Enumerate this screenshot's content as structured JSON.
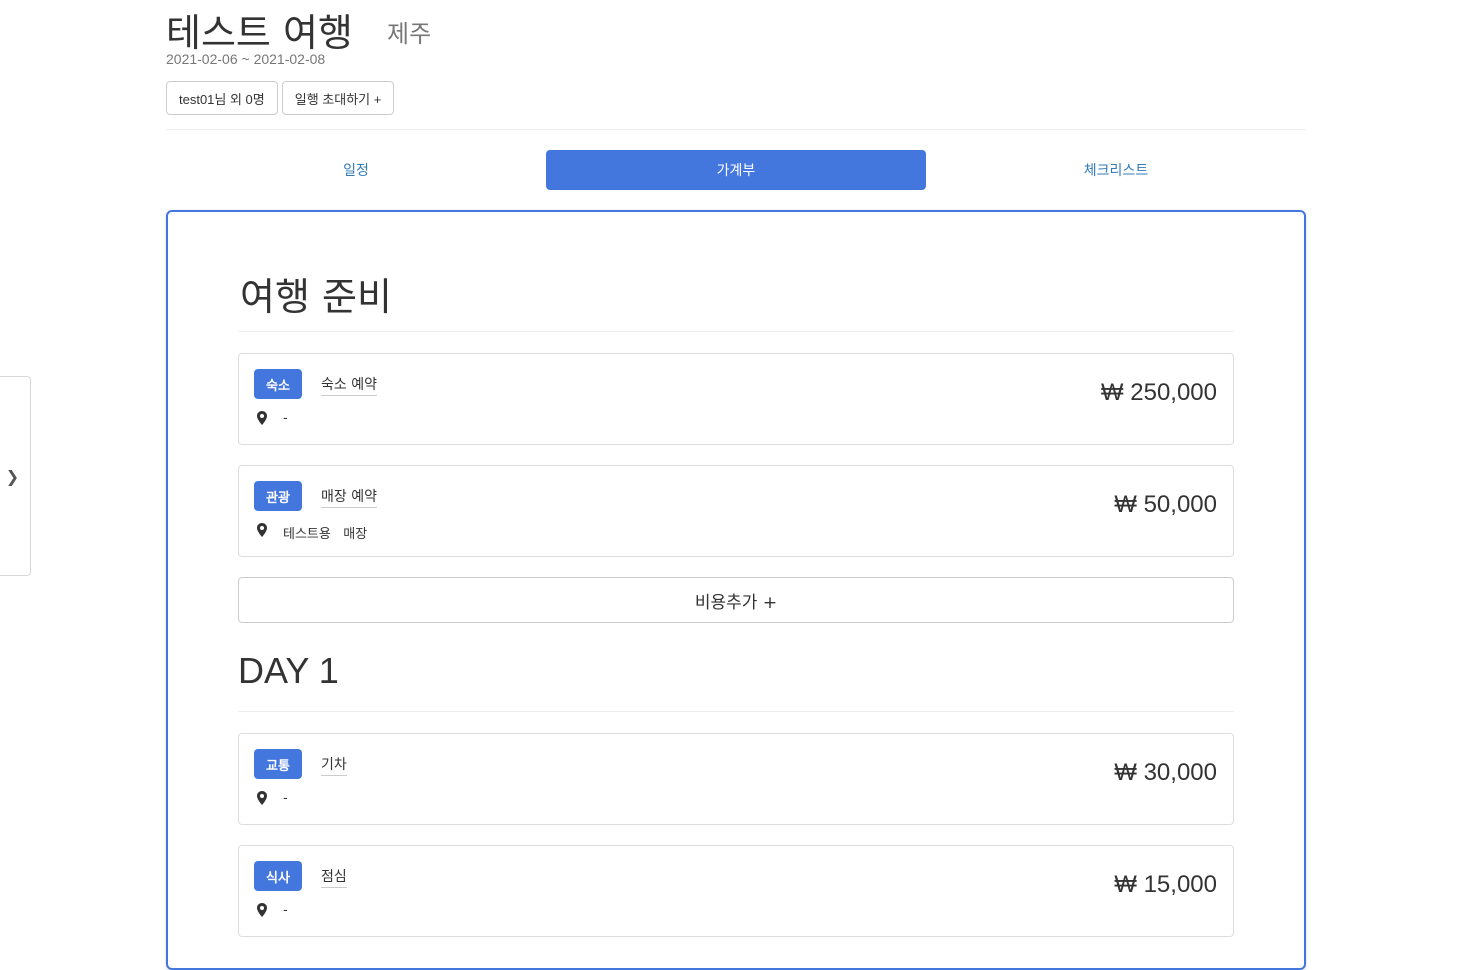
{
  "trip": {
    "title": "테스트 여행",
    "region": "제주",
    "dates": "2021-02-06 ~ 2021-02-08",
    "members_label": "test01님 외 0명",
    "invite_label": "일행 초대하기 +"
  },
  "tabs": [
    {
      "label": "일정",
      "active": false
    },
    {
      "label": "가계부",
      "active": true
    },
    {
      "label": "체크리스트",
      "active": false
    }
  ],
  "sidebar": {
    "toggle_icon": "chevron-right-icon"
  },
  "budget": {
    "prep": {
      "title": "여행 준비",
      "items": [
        {
          "category": "숙소",
          "name": "숙소 예약",
          "place": "-",
          "amount": "₩ 250,000"
        },
        {
          "category": "관광",
          "name": "매장 예약",
          "place": "테스트용   매장",
          "amount": "₩ 50,000"
        }
      ],
      "add_label": "비용추가 +"
    },
    "day1": {
      "title": "DAY 1",
      "items": [
        {
          "category": "교통",
          "name": "기차",
          "place": "-",
          "amount": "₩ 30,000"
        },
        {
          "category": "식사",
          "name": "점심",
          "place": "-",
          "amount": "₩ 15,000"
        }
      ]
    }
  },
  "colors": {
    "accent": "#4477dd",
    "tab_link": "#337ab7",
    "border": "#dddddd"
  }
}
